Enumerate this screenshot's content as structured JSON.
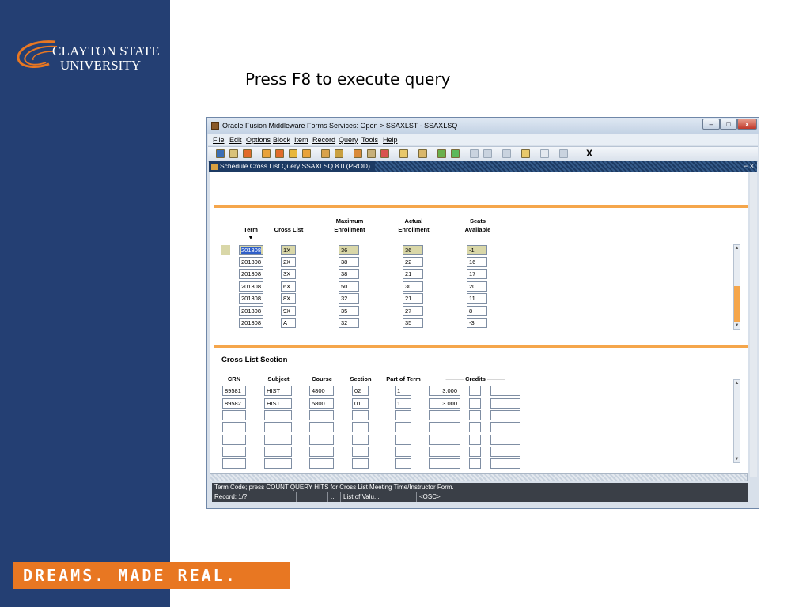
{
  "slide": {
    "logo_line1": "CLAYTON STATE",
    "logo_line2": "UNIVERSITY",
    "tagline": "DREAMS. MADE REAL.",
    "title": "Press F8 to execute query"
  },
  "window": {
    "title": "Oracle Fusion Middleware Forms Services:  Open > SSAXLST - SSAXLSQ",
    "min_label": "–",
    "max_label": "□",
    "close_label": "x",
    "menu": [
      "File",
      "Edit",
      "Options",
      "Block",
      "Item",
      "Record",
      "Query",
      "Tools",
      "Help"
    ],
    "toolbar_x": "X",
    "form_title": "Schedule Cross List Query  SSAXLSQ  8.0  (PROD)",
    "form_controls": "⌐ ×"
  },
  "top_block": {
    "headers": {
      "term": "Term",
      "cross_list": "Cross List",
      "max_enroll_1": "Maximum",
      "max_enroll_2": "Enrollment",
      "act_enroll_1": "Actual",
      "act_enroll_2": "Enrollment",
      "seats_1": "Seats",
      "seats_2": "Available"
    },
    "term_dropdown": "▼",
    "rows": [
      {
        "term": "201308",
        "cross_list": "1X",
        "max": "36",
        "actual": "36",
        "seats": "-1"
      },
      {
        "term": "201308",
        "cross_list": "2X",
        "max": "38",
        "actual": "22",
        "seats": "16"
      },
      {
        "term": "201308",
        "cross_list": "3X",
        "max": "38",
        "actual": "21",
        "seats": "17"
      },
      {
        "term": "201308",
        "cross_list": "6X",
        "max": "50",
        "actual": "30",
        "seats": "20"
      },
      {
        "term": "201308",
        "cross_list": "8X",
        "max": "32",
        "actual": "21",
        "seats": "11"
      },
      {
        "term": "201308",
        "cross_list": "9X",
        "max": "35",
        "actual": "27",
        "seats": "8"
      },
      {
        "term": "201308",
        "cross_list": "A",
        "max": "32",
        "actual": "35",
        "seats": "-3"
      }
    ]
  },
  "cross_list_section": {
    "title": "Cross List Section",
    "headers": {
      "crn": "CRN",
      "subject": "Subject",
      "course": "Course",
      "section": "Section",
      "part_of_term": "Part of Term",
      "credits": "——— Credits ———"
    },
    "rows": [
      {
        "crn": "89581",
        "subject": "HIST",
        "course": "4800",
        "section": "02",
        "part_of_term": "1",
        "credits": "3.000"
      },
      {
        "crn": "89582",
        "subject": "HIST",
        "course": "5800",
        "section": "01",
        "part_of_term": "1",
        "credits": "3.000"
      },
      {
        "crn": "",
        "subject": "",
        "course": "",
        "section": "",
        "part_of_term": "",
        "credits": ""
      },
      {
        "crn": "",
        "subject": "",
        "course": "",
        "section": "",
        "part_of_term": "",
        "credits": ""
      },
      {
        "crn": "",
        "subject": "",
        "course": "",
        "section": "",
        "part_of_term": "",
        "credits": ""
      },
      {
        "crn": "",
        "subject": "",
        "course": "",
        "section": "",
        "part_of_term": "",
        "credits": ""
      },
      {
        "crn": "",
        "subject": "",
        "course": "",
        "section": "",
        "part_of_term": "",
        "credits": ""
      }
    ]
  },
  "status": {
    "message": "Term Code; press COUNT QUERY HITS for Cross List Meeting Time/Instructor Form.",
    "record": "Record: 1/?",
    "ellipsis": "...",
    "list_of_values": "List of Valu...",
    "osc": "<OSC>"
  },
  "colors": {
    "slide_panel": "#243f73",
    "accent_orange": "#e87722",
    "highlight_field": "#d9d7a8",
    "selection": "#2f5fc9"
  }
}
